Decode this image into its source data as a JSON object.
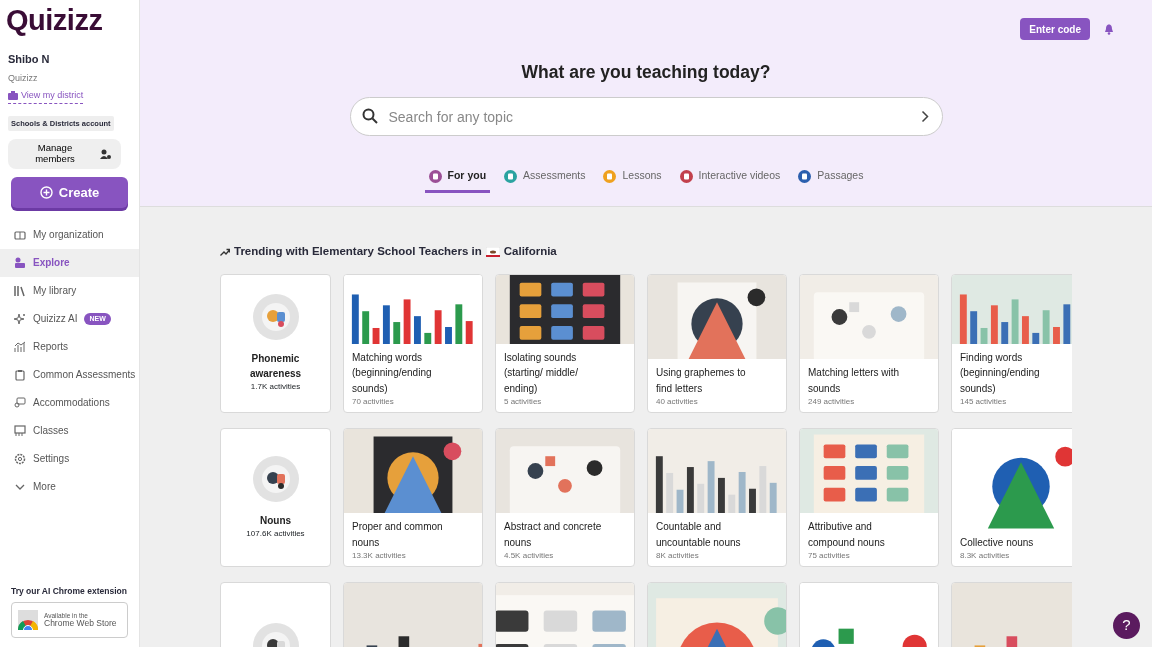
{
  "logo": "Quizizz",
  "user": {
    "name": "Shibo N",
    "org": "Quizizz",
    "district_link": "View my district",
    "account_badge": "Schools & Districts account"
  },
  "manage_button": "Manage members",
  "create_button": "Create",
  "nav": [
    {
      "label": "My organization",
      "selected": false
    },
    {
      "label": "Explore",
      "selected": true
    },
    {
      "label": "My library",
      "selected": false
    },
    {
      "label": "Quizizz AI",
      "selected": false,
      "badge": "NEW"
    },
    {
      "label": "Reports",
      "selected": false
    },
    {
      "label": "Common Assessments",
      "selected": false
    },
    {
      "label": "Accommodations",
      "selected": false
    },
    {
      "label": "Classes",
      "selected": false
    },
    {
      "label": "Settings",
      "selected": false
    },
    {
      "label": "More",
      "selected": false
    }
  ],
  "extension": {
    "title": "Try our AI Chrome extension",
    "line1": "Available in the",
    "line2": "Chrome Web Store"
  },
  "enter_code": "Enter code",
  "heading": "What are you teaching today?",
  "search": {
    "placeholder": "Search for any topic"
  },
  "tabs": [
    {
      "label": "For you",
      "selected": true,
      "color": "#9b4f96"
    },
    {
      "label": "Assessments",
      "selected": false,
      "color": "#2aa3a0"
    },
    {
      "label": "Lessons",
      "selected": false,
      "color": "#efa11f"
    },
    {
      "label": "Interactive videos",
      "selected": false,
      "color": "#c2404c"
    },
    {
      "label": "Passages",
      "selected": false,
      "color": "#2b5fae"
    }
  ],
  "section": {
    "title": "Trending with Elementary School Teachers in",
    "place": "California"
  },
  "rows": [
    {
      "cards": [
        {
          "kind": "category",
          "title": "Phonemic awareness",
          "count": "1.7K activities"
        },
        {
          "kind": "topic",
          "title": "Matching words (beginning/ending sounds)",
          "count": "70 activities"
        },
        {
          "kind": "topic",
          "title": "Isolating sounds (starting/ middle/ ending)",
          "count": "5 activities"
        },
        {
          "kind": "topic",
          "title": "Using graphemes to find letters",
          "count": "40 activities"
        },
        {
          "kind": "topic",
          "title": "Matching letters with sounds",
          "count": "249 activities"
        },
        {
          "kind": "topic",
          "title": "Finding words (beginning/ending sounds)",
          "count": "145 activities"
        }
      ]
    },
    {
      "cards": [
        {
          "kind": "category",
          "title": "Nouns",
          "count": "107.6K activities"
        },
        {
          "kind": "topic",
          "title": "Proper and common nouns",
          "count": "13.3K activities"
        },
        {
          "kind": "topic",
          "title": "Abstract and concrete nouns",
          "count": "4.5K activities"
        },
        {
          "kind": "topic",
          "title": "Countable and uncountable nouns",
          "count": "8K activities"
        },
        {
          "kind": "topic",
          "title": "Attributive and compound nouns",
          "count": "75 activities"
        },
        {
          "kind": "topic",
          "title": "Collective nouns",
          "count": "8.3K activities"
        }
      ]
    },
    {
      "cards": [
        {
          "kind": "category"
        },
        {
          "kind": "topic"
        },
        {
          "kind": "topic"
        },
        {
          "kind": "topic"
        },
        {
          "kind": "topic"
        },
        {
          "kind": "topic"
        }
      ]
    }
  ],
  "help": "?"
}
